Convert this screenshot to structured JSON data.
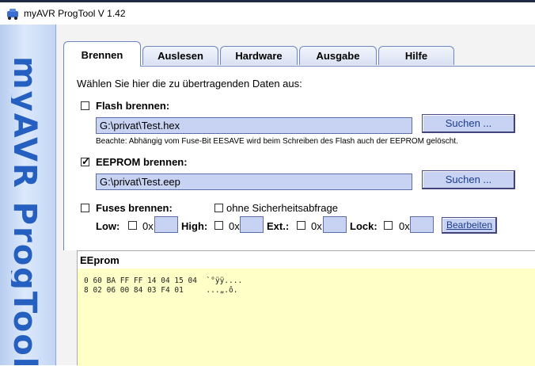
{
  "window": {
    "title": "myAVR ProgTool V 1.42"
  },
  "sidebar": {
    "brand_text": "myAVR ProgTool"
  },
  "tabs": [
    {
      "label": "Brennen",
      "active": true
    },
    {
      "label": "Auslesen",
      "active": false
    },
    {
      "label": "Hardware",
      "active": false
    },
    {
      "label": "Ausgabe",
      "active": false
    },
    {
      "label": "Hilfe",
      "active": false
    }
  ],
  "burn": {
    "instruction": "Wählen Sie hier die zu übertragenden Daten aus:",
    "flash": {
      "label": "Flash brennen:",
      "checked": false,
      "path": "G:\\privat\\Test.hex",
      "search_label": "Suchen ..."
    },
    "note": "Beachte: Abhängig vom Fuse-Bit EESAVE wird beim Schreiben des Flash auch der EEPROM gelöscht.",
    "eeprom": {
      "label": "EEPROM brennen:",
      "checked": true,
      "path": "G:\\privat\\Test.eep",
      "search_label": "Suchen ..."
    },
    "fuses": {
      "label": "Fuses brennen:",
      "checked": false,
      "no_confirm_label": "ohne Sicherheitsabfrage",
      "low_label": "Low:",
      "high_label": "High:",
      "ext_label": "Ext.:",
      "lock_label": "Lock:",
      "hex_prefix": "0x",
      "edit_label": "Bearbeiten"
    }
  },
  "eeprom_view": {
    "title": "EEprom",
    "lines": [
      "0 60 BA FF FF 14 04 15 04  `°ÿÿ....",
      "8 02 06 00 84 03 F4 01     ...„.ô."
    ]
  },
  "colors": {
    "accent": "#2560c0",
    "field_bg": "#c8d3f3",
    "hex_bg": "#ffffc8"
  }
}
